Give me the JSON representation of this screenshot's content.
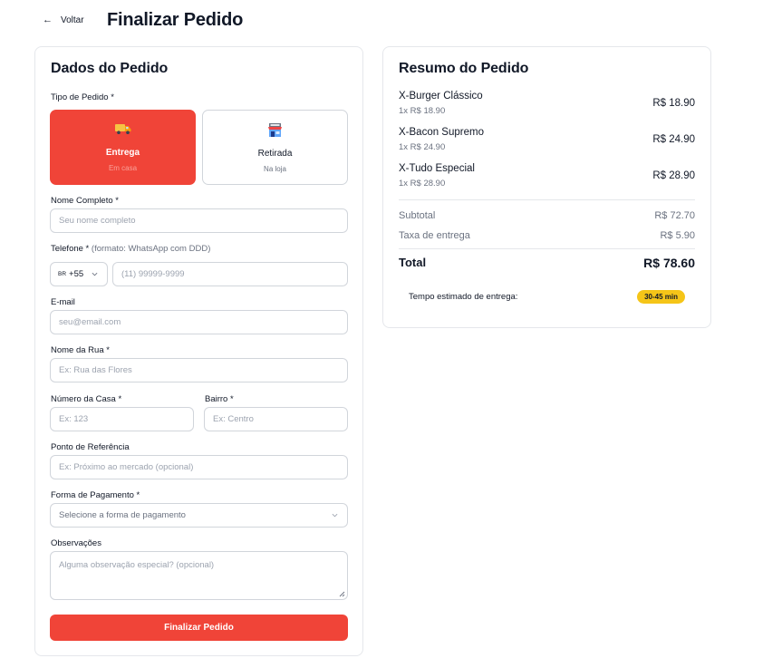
{
  "header": {
    "back_label": "Voltar",
    "title": "Finalizar Pedido"
  },
  "form": {
    "title": "Dados do Pedido",
    "order_type_label": "Tipo de Pedido *",
    "order_types": [
      {
        "label": "Entrega",
        "sub": "Em casa",
        "icon": "truck-icon",
        "active": true
      },
      {
        "label": "Retirada",
        "sub": "Na loja",
        "icon": "store-icon",
        "active": false
      }
    ],
    "name_label": "Nome Completo *",
    "name_placeholder": "Seu nome completo",
    "phone_label": "Telefone *",
    "phone_hint": "(formato: WhatsApp com DDD)",
    "country_flag": "BR",
    "country_code": "+55",
    "phone_placeholder": "(11) 99999-9999",
    "email_label": "E-mail",
    "email_placeholder": "seu@email.com",
    "street_label": "Nome da Rua *",
    "street_placeholder": "Ex: Rua das Flores",
    "number_label": "Número da Casa *",
    "number_placeholder": "Ex: 123",
    "district_label": "Bairro *",
    "district_placeholder": "Ex: Centro",
    "reference_label": "Ponto de Referência",
    "reference_placeholder": "Ex: Próximo ao mercado (opcional)",
    "payment_label": "Forma de Pagamento *",
    "payment_placeholder": "Selecione a forma de pagamento",
    "notes_label": "Observações",
    "notes_placeholder": "Alguma observação especial? (opcional)",
    "submit_label": "Finalizar Pedido"
  },
  "summary": {
    "title": "Resumo do Pedido",
    "items": [
      {
        "name": "X-Burger Clássico",
        "qty": "1x R$ 18.90",
        "price": "R$ 18.90"
      },
      {
        "name": "X-Bacon Supremo",
        "qty": "1x R$ 24.90",
        "price": "R$ 24.90"
      },
      {
        "name": "X-Tudo Especial",
        "qty": "1x R$ 28.90",
        "price": "R$ 28.90"
      }
    ],
    "subtotal_label": "Subtotal",
    "subtotal_value": "R$ 72.70",
    "delivery_label": "Taxa de entrega",
    "delivery_value": "R$ 5.90",
    "total_label": "Total",
    "total_value": "R$ 78.60",
    "eta_label": "Tempo estimado de entrega:",
    "eta_value": "30-45 min"
  },
  "colors": {
    "accent": "#f04438",
    "badge": "#f5c518"
  }
}
